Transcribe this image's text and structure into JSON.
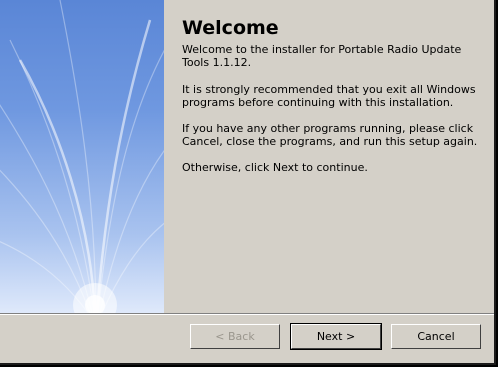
{
  "wizard": {
    "title": "Welcome",
    "paragraphs": [
      "Welcome to the installer for Portable Radio Update Tools 1.1.12.",
      "It is strongly recommended that you exit all Windows programs before continuing with this installation.",
      "If you have any other programs running, please click Cancel, close the programs, and run this setup again.",
      "Otherwise, click Next to continue."
    ]
  },
  "buttons": {
    "back_label": "< Back",
    "next_label": "Next >",
    "cancel_label": "Cancel",
    "back_enabled": false
  },
  "colors": {
    "dialog_bg": "#d4d0c8",
    "banner_top": "#5a86d6",
    "banner_bottom": "#dfe9fb"
  }
}
